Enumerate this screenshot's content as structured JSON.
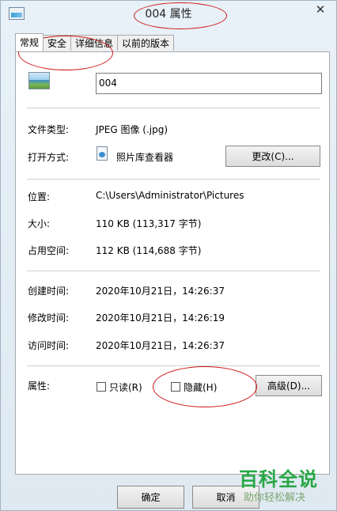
{
  "window": {
    "title": "004 属性",
    "close_glyph": "✕"
  },
  "tabs": [
    {
      "label": "常规"
    },
    {
      "label": "安全"
    },
    {
      "label": "详细信息"
    },
    {
      "label": "以前的版本"
    }
  ],
  "general": {
    "file_name": "004",
    "file_type_label": "文件类型:",
    "file_type_value": "JPEG 图像 (.jpg)",
    "open_with_label": "打开方式:",
    "open_with_app": "照片库查看器",
    "change_button": "更改(C)...",
    "location_label": "位置:",
    "location_value": "C:\\Users\\Administrator\\Pictures",
    "size_label": "大小:",
    "size_value": "110 KB (113,317 字节)",
    "size_on_disk_label": "占用空间:",
    "size_on_disk_value": "112 KB (114,688 字节)",
    "created_label": "创建时间:",
    "created_value": "2020年10月21日，14:26:37",
    "modified_label": "修改时间:",
    "modified_value": "2020年10月21日，14:26:19",
    "accessed_label": "访问时间:",
    "accessed_value": "2020年10月21日，14:26:37",
    "attributes_label": "属性:",
    "readonly_label": "只读(R)",
    "hidden_label": "隐藏(H)",
    "advanced_button": "高级(D)..."
  },
  "footer": {
    "ok_button": "确定",
    "cancel_button": "取消"
  },
  "watermark": {
    "title": "百科全说",
    "subtitle": "助你轻松解决"
  },
  "colors": {
    "annotation": "#d01818",
    "watermark": "#28a745"
  }
}
